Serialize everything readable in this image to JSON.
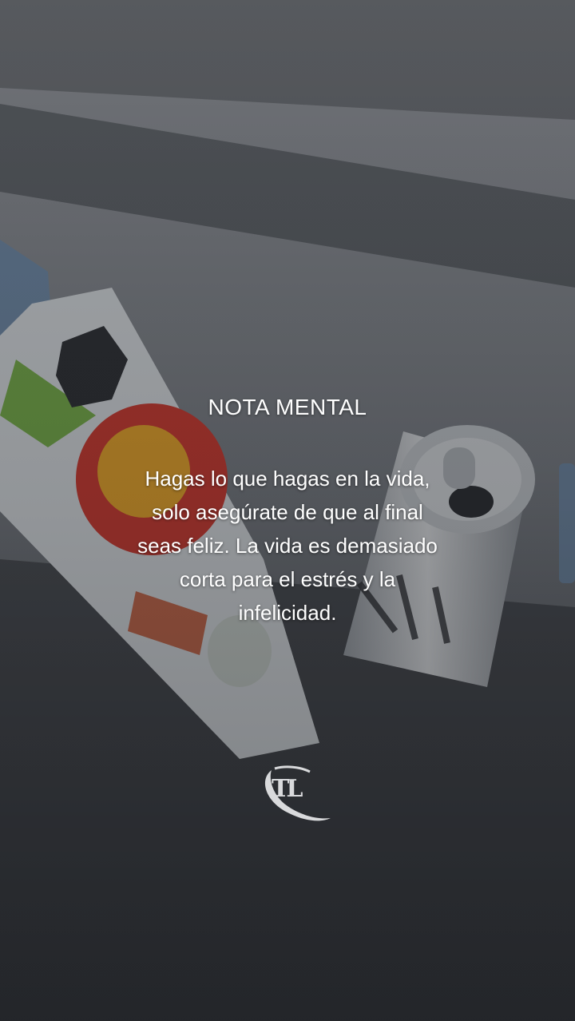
{
  "note": {
    "title": "NOTA MENTAL",
    "quote": "Hagas lo que hagas en la vida, solo asegúrate de que al final seas feliz. La vida es demasiado corta para el estrés y la infelicidad."
  },
  "logo": {
    "letters": "TL",
    "icon": "swoosh-monogram-icon"
  },
  "colors": {
    "text": "#ffffff",
    "logo": "#d9dadc"
  }
}
